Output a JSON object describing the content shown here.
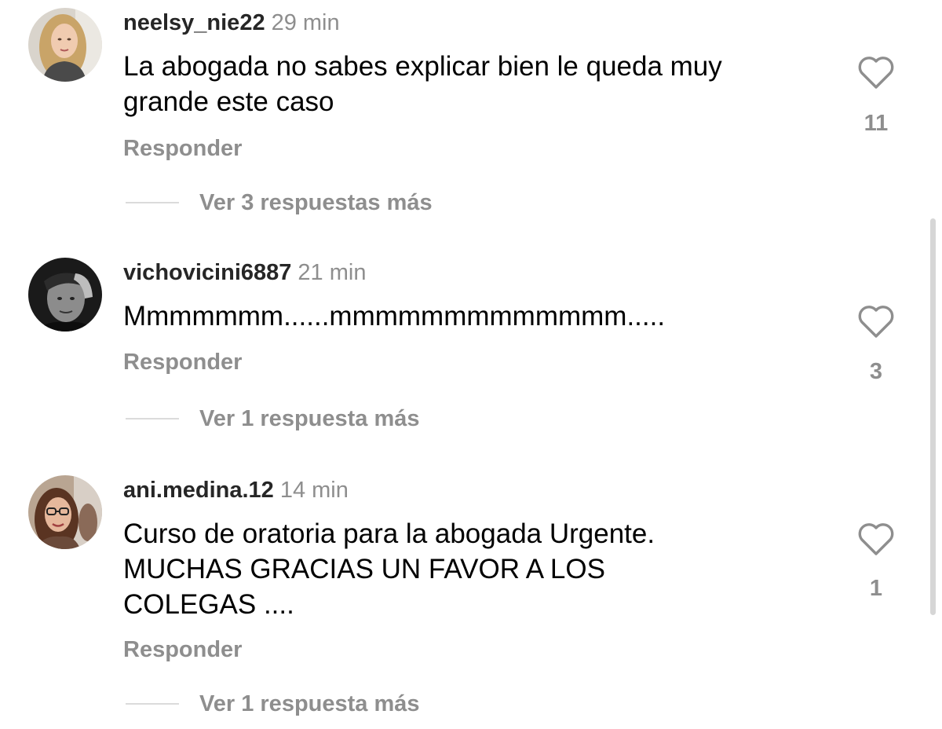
{
  "comments": [
    {
      "username": "neelsy_nie22",
      "time": "29 min",
      "text_lines": [
        "La abogada no sabes explicar bien le queda muy",
        "grande este caso"
      ],
      "reply_label": "Responder",
      "like_count": "11",
      "more_replies_label": "Ver 3 respuestas más",
      "avatar_icon": "profile-photo-blonde-woman"
    },
    {
      "username": "vichovicini6887",
      "time": "21 min",
      "text_lines": [
        "Mmmmmmm......mmmmmmmmmmmmm....."
      ],
      "reply_label": "Responder",
      "like_count": "3",
      "more_replies_label": "Ver 1 respuesta más",
      "avatar_icon": "profile-photo-man-grayscale"
    },
    {
      "username": "ani.medina.12",
      "time": "14 min",
      "text_lines": [
        "Curso de oratoria para la abogada Urgente.",
        "MUCHAS GRACIAS UN FAVOR A LOS",
        "COLEGAS ...."
      ],
      "reply_label": "Responder",
      "like_count": "1",
      "more_replies_label": "Ver 1 respuesta más",
      "avatar_icon": "profile-photo-woman-glasses"
    }
  ],
  "icons": {
    "like": "heart-outline-icon"
  },
  "colors": {
    "username": "#262626",
    "secondary_text": "#8e8e8e",
    "divider": "#dbdbdb"
  }
}
